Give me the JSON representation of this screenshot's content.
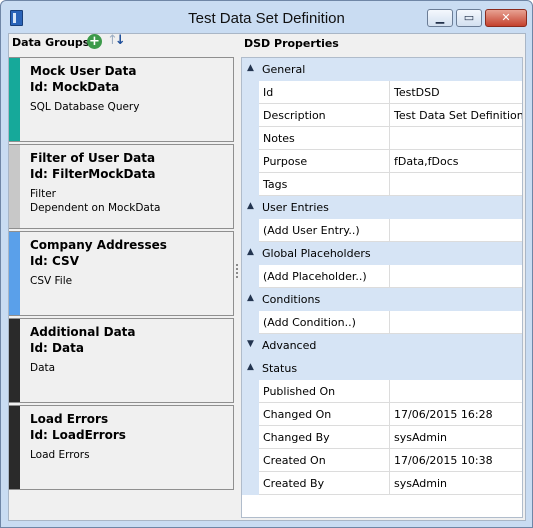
{
  "window": {
    "title": "Test Data Set Definition",
    "minimize_glyph": "▁",
    "maximize_glyph": "▭",
    "close_glyph": "✕"
  },
  "left_panel": {
    "header": "Data Groups",
    "add_glyph": "+",
    "sort_glyph_up": "↑",
    "sort_glyph_down": "↓",
    "groups": [
      {
        "name": "Mock User Data",
        "id": "Id: MockData",
        "desc1": "SQL Database Query",
        "desc2": "",
        "color": "#16a99a"
      },
      {
        "name": "Filter of User Data",
        "id": "Id: FilterMockData",
        "desc1": "Filter",
        "desc2": "Dependent on MockData",
        "color": "#c8c8c8"
      },
      {
        "name": "Company Addresses",
        "id": "Id: CSV",
        "desc1": "CSV File",
        "desc2": "",
        "color": "#5aa0ea"
      },
      {
        "name": "Additional Data",
        "id": "Id: Data",
        "desc1": "Data",
        "desc2": "",
        "color": "#2a2a2a"
      },
      {
        "name": "Load Errors",
        "id": "Id: LoadErrors",
        "desc1": "Load Errors",
        "desc2": "",
        "color": "#2a2a2a"
      }
    ]
  },
  "right_panel": {
    "header": "DSD Properties",
    "categories": {
      "general": "General",
      "user_entries": "User Entries",
      "global_placeholders": "Global Placeholders",
      "conditions": "Conditions",
      "advanced": "Advanced",
      "status": "Status"
    },
    "general_rows": [
      {
        "key": "Id",
        "value": "TestDSD"
      },
      {
        "key": "Description",
        "value": "Test Data Set Definition"
      },
      {
        "key": "Notes",
        "value": ""
      },
      {
        "key": "Purpose",
        "value": "fData,fDocs"
      },
      {
        "key": "Tags",
        "value": ""
      }
    ],
    "user_entries_row": {
      "key": "(Add User Entry..)",
      "value": ""
    },
    "placeholders_row": {
      "key": "(Add Placeholder..)",
      "value": ""
    },
    "conditions_row": {
      "key": "(Add Condition..)",
      "value": ""
    },
    "status_rows": [
      {
        "key": "Published On",
        "value": ""
      },
      {
        "key": "Changed On",
        "value": "17/06/2015 16:28"
      },
      {
        "key": "Changed By",
        "value": "sysAdmin"
      },
      {
        "key": "Created On",
        "value": "17/06/2015 10:38"
      },
      {
        "key": "Created By",
        "value": "sysAdmin"
      }
    ],
    "expanded_glyph": "▲",
    "collapsed_glyph": "▼"
  }
}
